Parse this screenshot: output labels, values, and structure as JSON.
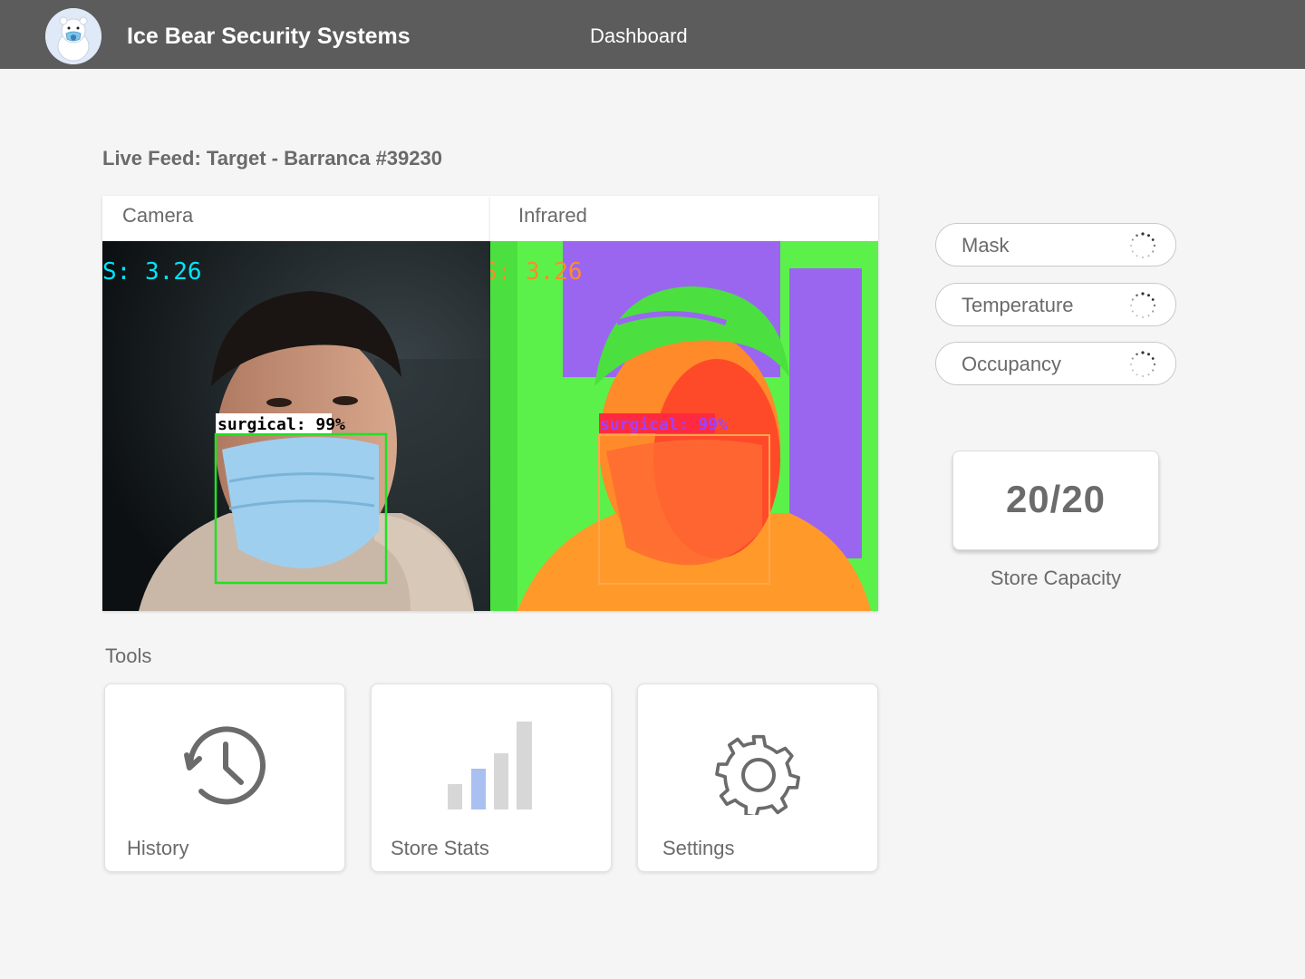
{
  "header": {
    "brand": "Ice Bear Security Systems",
    "nav_dashboard": "Dashboard",
    "logo_icon": "polar-bear-mask-logo"
  },
  "feed": {
    "title": "Live Feed: Target - Barranca #39230",
    "camera": {
      "label": "Camera",
      "fps_text": "S: 3.26",
      "detection_label": "surgical: 99%"
    },
    "infrared": {
      "label": "Infrared",
      "fps_text": "S: 3.26",
      "detection_label": "surgical: 99%"
    }
  },
  "status": {
    "mask": "Mask",
    "temperature": "Temperature",
    "occupancy": "Occupancy",
    "spinner_icon": "loading-spinner-icon"
  },
  "capacity": {
    "value": "20/20",
    "label": "Store Capacity"
  },
  "tools": {
    "title": "Tools",
    "items": [
      {
        "label": "History",
        "icon": "history-clock-icon"
      },
      {
        "label": "Store Stats",
        "icon": "bar-chart-icon"
      },
      {
        "label": "Settings",
        "icon": "gear-icon"
      }
    ]
  },
  "colors": {
    "header_bg": "#5c5c5c",
    "page_bg": "#f5f5f5",
    "text_gray": "#6a6a6a",
    "fps_cyan": "#00e5ff",
    "fps_orange": "#ff8c2a",
    "detection_green": "#22e022",
    "stats_accent": "#a9c0f0"
  }
}
